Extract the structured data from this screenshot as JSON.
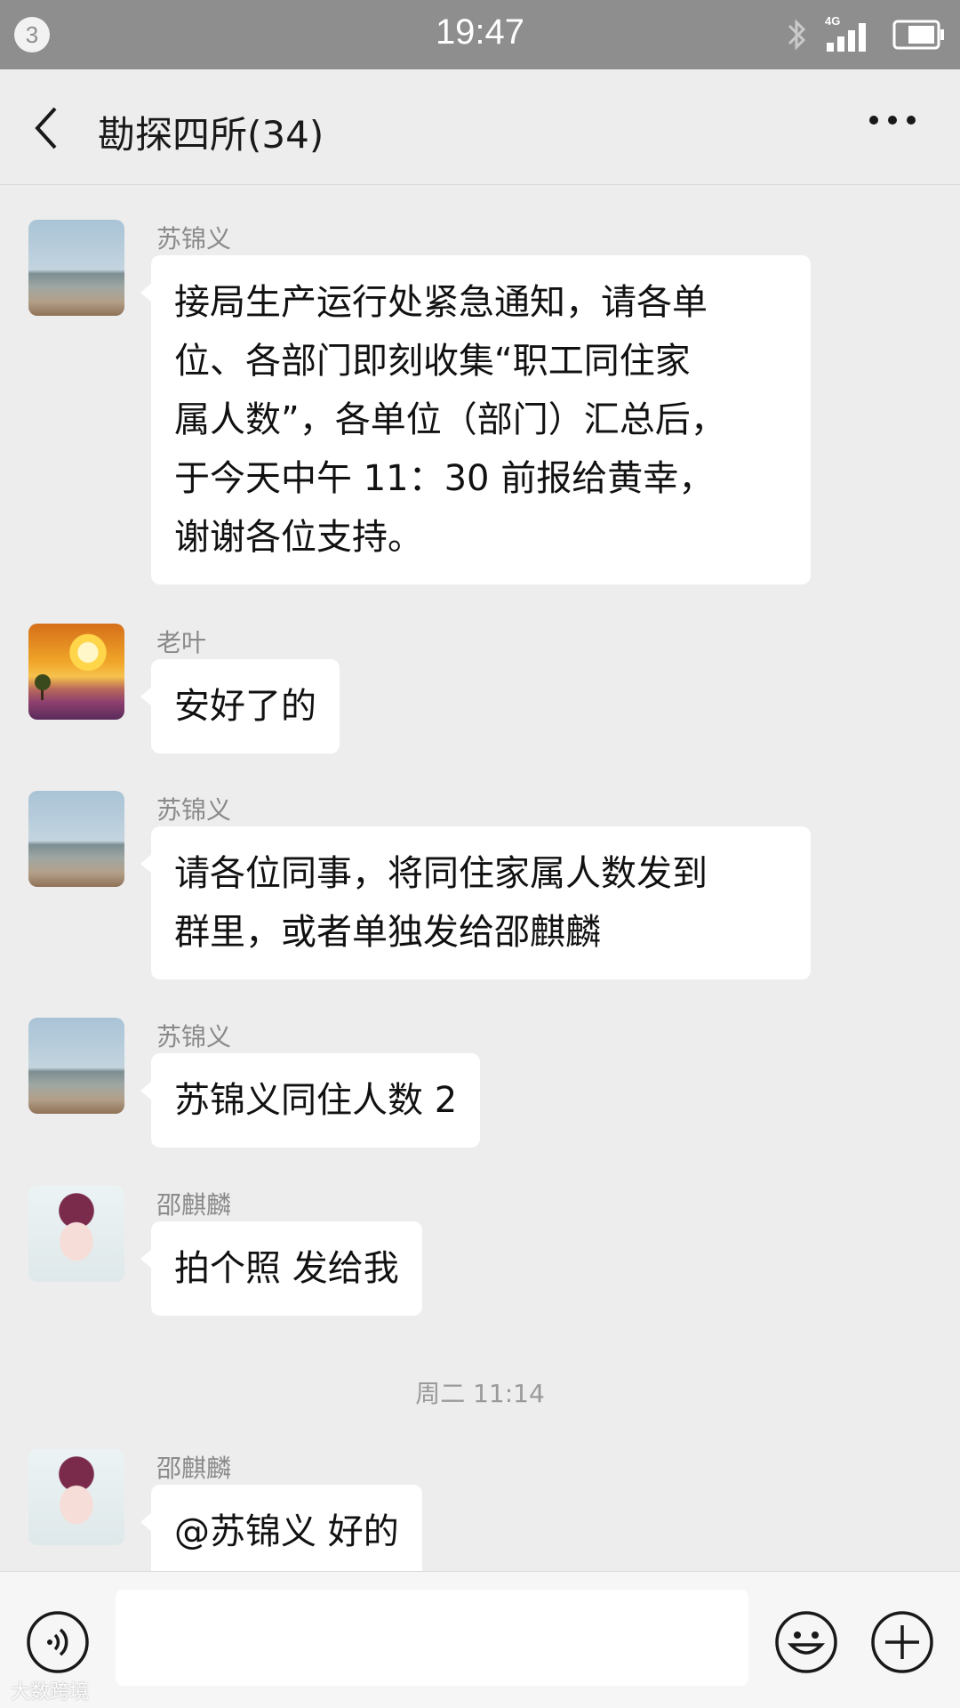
{
  "status_bar": {
    "notification_count": "3",
    "time": "19:47",
    "network": "4G",
    "icons": [
      "bluetooth-icon",
      "signal-icon",
      "battery-icon"
    ]
  },
  "header": {
    "title": "勘探四所(34)",
    "icons": [
      "back-icon",
      "more-icon"
    ]
  },
  "messages": [
    {
      "sender": "苏锦义",
      "avatar": "sea",
      "lines": [
        "接局生产运行处紧急通知，请各单",
        "位、各部门即刻收集“职工同住家",
        "属人数”，各单位（部门）汇总后，",
        "于今天中午 11：30 前报给黄幸，",
        "谢谢各位支持。"
      ]
    },
    {
      "sender": "老叶",
      "avatar": "sunset",
      "lines": [
        "安好了的"
      ]
    },
    {
      "sender": "苏锦义",
      "avatar": "sea",
      "lines": [
        "请各位同事，将同住家属人数发到",
        "群里，或者单独发给邵麒麟"
      ]
    },
    {
      "sender": "苏锦义",
      "avatar": "sea",
      "lines": [
        "苏锦义同住人数 2"
      ]
    },
    {
      "sender": "邵麒麟",
      "avatar": "opera",
      "lines": [
        "拍个照 发给我"
      ]
    },
    {
      "sender": "邵麒麟",
      "avatar": "opera",
      "lines": [
        "@苏锦义  好的"
      ]
    }
  ],
  "time_separator": "周二 11:14",
  "input_bar": {
    "value": "",
    "icons": [
      "voice-icon",
      "emoji-icon",
      "plus-icon"
    ]
  },
  "watermark": "大数跨境",
  "colors": {
    "status_bar": "#8e8e8e",
    "background": "#ededed",
    "bubble": "#ffffff"
  }
}
